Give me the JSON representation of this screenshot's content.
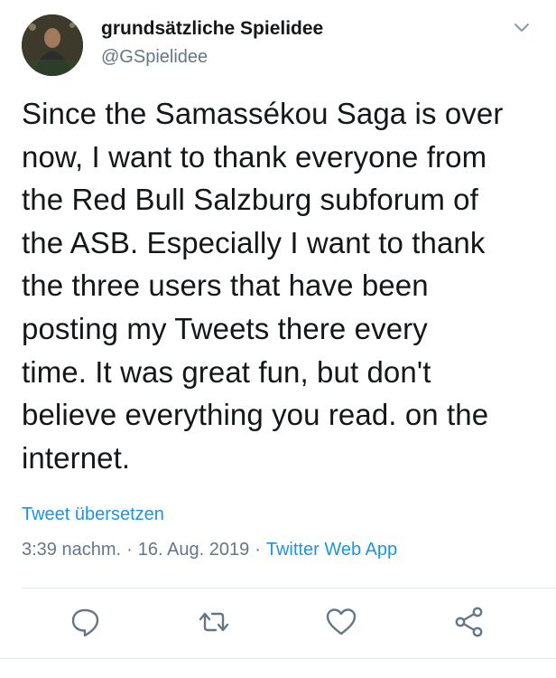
{
  "tweet": {
    "author": {
      "display_name": "grundsätzliche Spielidee",
      "handle": "@GSpielidee",
      "avatar_icon": "profile-photo"
    },
    "text": "Since the Samassékou Saga is over\nnow, I want to thank everyone from\nthe Red Bull Salzburg subforum of\nthe ASB. Especially I want to thank\nthe three users that have been\nposting my Tweets there every\ntime. It was great fun, but don't\nbelieve everything you read. on the\ninternet.",
    "translate_label": "Tweet übersetzen",
    "time": "3:39 nachm.",
    "separator": "·",
    "date": "16. Aug. 2019",
    "source": "Twitter Web App"
  },
  "actions": [
    {
      "name": "reply",
      "icon": "comment-icon"
    },
    {
      "name": "retweet",
      "icon": "retweet-icon"
    },
    {
      "name": "like",
      "icon": "heart-icon"
    },
    {
      "name": "share",
      "icon": "share-icon"
    }
  ],
  "colors": {
    "link_blue": "#1b95e0",
    "secondary_gray": "#657786",
    "text": "#14171a",
    "divider": "#e1e8ed"
  }
}
